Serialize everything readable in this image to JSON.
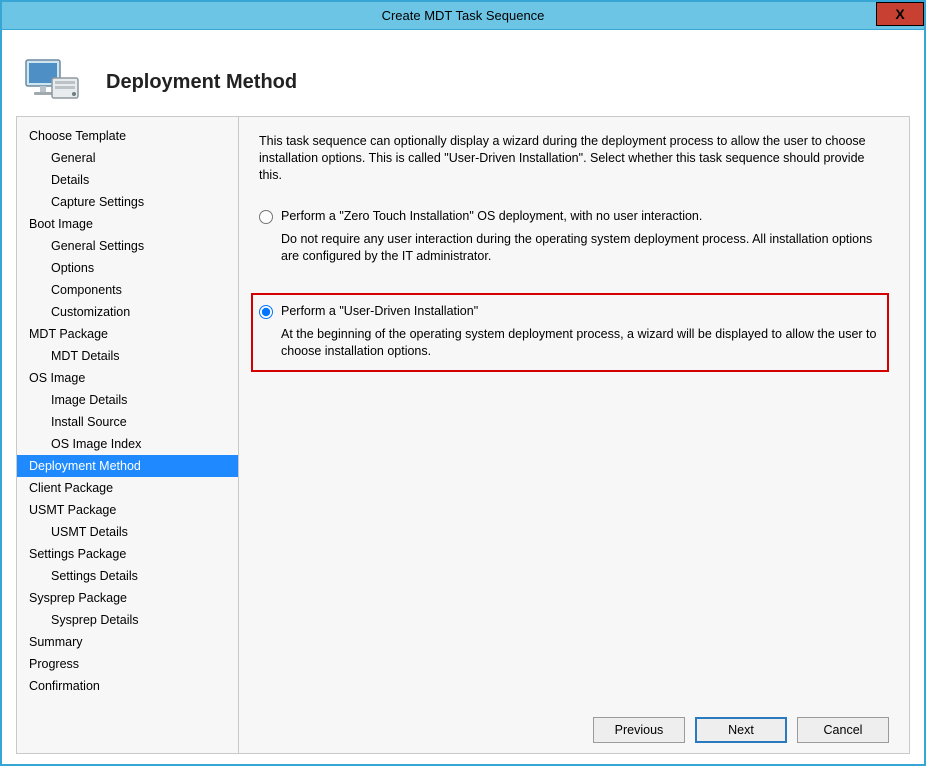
{
  "window": {
    "title": "Create MDT Task Sequence",
    "close_label": "X"
  },
  "header": {
    "heading": "Deployment Method"
  },
  "sidebar": {
    "items": [
      {
        "label": "Choose Template",
        "child": false,
        "selected": false
      },
      {
        "label": "General",
        "child": true,
        "selected": false
      },
      {
        "label": "Details",
        "child": true,
        "selected": false
      },
      {
        "label": "Capture Settings",
        "child": true,
        "selected": false
      },
      {
        "label": "Boot Image",
        "child": false,
        "selected": false
      },
      {
        "label": "General Settings",
        "child": true,
        "selected": false
      },
      {
        "label": "Options",
        "child": true,
        "selected": false
      },
      {
        "label": "Components",
        "child": true,
        "selected": false
      },
      {
        "label": "Customization",
        "child": true,
        "selected": false
      },
      {
        "label": "MDT Package",
        "child": false,
        "selected": false
      },
      {
        "label": "MDT Details",
        "child": true,
        "selected": false
      },
      {
        "label": "OS Image",
        "child": false,
        "selected": false
      },
      {
        "label": "Image Details",
        "child": true,
        "selected": false
      },
      {
        "label": "Install Source",
        "child": true,
        "selected": false
      },
      {
        "label": "OS Image Index",
        "child": true,
        "selected": false
      },
      {
        "label": "Deployment Method",
        "child": false,
        "selected": true
      },
      {
        "label": "Client Package",
        "child": false,
        "selected": false
      },
      {
        "label": "USMT Package",
        "child": false,
        "selected": false
      },
      {
        "label": "USMT Details",
        "child": true,
        "selected": false
      },
      {
        "label": "Settings Package",
        "child": false,
        "selected": false
      },
      {
        "label": "Settings Details",
        "child": true,
        "selected": false
      },
      {
        "label": "Sysprep Package",
        "child": false,
        "selected": false
      },
      {
        "label": "Sysprep Details",
        "child": true,
        "selected": false
      },
      {
        "label": "Summary",
        "child": false,
        "selected": false
      },
      {
        "label": "Progress",
        "child": false,
        "selected": false
      },
      {
        "label": "Confirmation",
        "child": false,
        "selected": false
      }
    ]
  },
  "content": {
    "intro": "This task sequence can optionally display a wizard during the deployment process to allow the user to choose installation options.  This is called \"User-Driven Installation\".  Select whether this task sequence should provide this.",
    "options": {
      "zero": {
        "label": "Perform a \"Zero Touch Installation\" OS deployment, with no user interaction.",
        "desc": "Do not require any user interaction during the operating system deployment process.  All installation options are configured by the IT administrator."
      },
      "udi": {
        "label": "Perform a \"User-Driven Installation\"",
        "desc": "At the beginning of the operating system deployment process, a wizard will be displayed to allow the user to choose installation options."
      },
      "selected": "udi"
    }
  },
  "buttons": {
    "previous": "Previous",
    "next": "Next",
    "cancel": "Cancel"
  }
}
